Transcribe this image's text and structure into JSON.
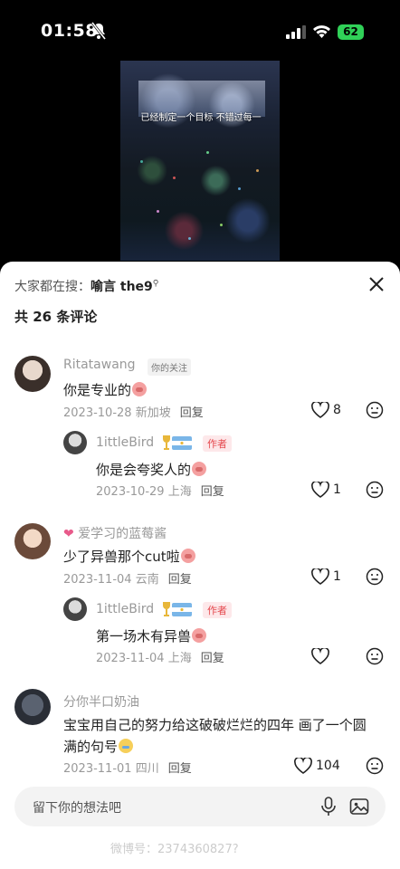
{
  "status": {
    "time": "01:58",
    "battery": "62"
  },
  "video": {
    "caption": "已经制定一个目标 不错过每一"
  },
  "sheet": {
    "search_prefix": "大家都在搜：",
    "search_term": "喻言 the9",
    "count_label": "共 26 条评论",
    "reply_label": "回复",
    "input_placeholder": "留下你的想法吧",
    "watermark": "微博号：2374360827?"
  },
  "comments": [
    {
      "user": "Ritatawang",
      "tag": "你的关注",
      "text": "你是专业的",
      "date": "2023-10-28",
      "location": "新加坡",
      "likes": "8"
    },
    {
      "user": "1ittleBird",
      "tag": "作者",
      "text": "你是会夸奖人的",
      "date": "2023-10-29",
      "location": "上海",
      "likes": "1"
    },
    {
      "user": "爱学习的蓝莓酱",
      "text": "少了异兽那个cut啦",
      "date": "2023-11-04",
      "location": "云南",
      "likes": "1"
    },
    {
      "user": "1ittleBird",
      "tag": "作者",
      "text": "第一场木有异兽",
      "date": "2023-11-04",
      "location": "上海",
      "likes": ""
    },
    {
      "user": "分你半口奶油",
      "text_line1": "宝宝用自己的努力给这破破烂烂的四年 画了一个圆",
      "text_line2": "满的句号",
      "date": "2023-11-01",
      "location": "四川",
      "likes": "104"
    }
  ],
  "colors": {
    "author_tag": "#e5484d",
    "battery": "#30d158",
    "muted": "#999999"
  }
}
